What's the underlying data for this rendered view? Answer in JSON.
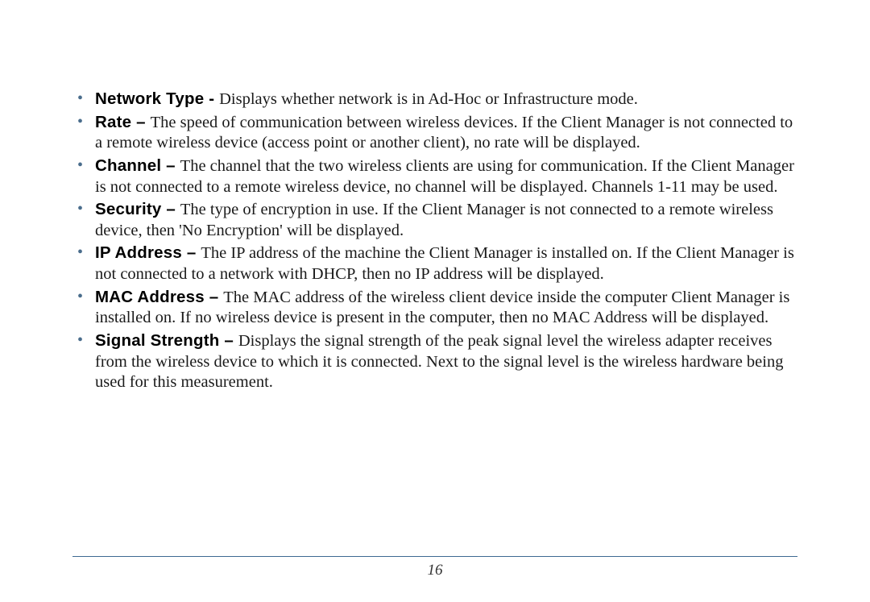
{
  "page_number": "16",
  "items": [
    {
      "term": "Network Type - ",
      "desc": "Displays whether network is in Ad-Hoc or Infrastructure mode."
    },
    {
      "term": "Rate – ",
      "desc": "The speed of communication between wireless devices.  If the Client Manager is not connected to a remote wireless device (access point or another client), no rate will be displayed."
    },
    {
      "term": "Channel – ",
      "desc": "The channel that the two wireless clients are using for communication.  If the Client Manager is not connected to a remote wireless device, no channel will be displayed.  Channels 1-11 may be used."
    },
    {
      "term": "Security – ",
      "desc": "The type of encryption in use.  If the Client Manager is not connected to a remote wireless device, then 'No Encryption' will be displayed."
    },
    {
      "term": "IP Address – ",
      "desc": "The IP address of the machine the Client Manager is installed on. If the Client Manager is not connected to a network with DHCP, then no IP address will be displayed."
    },
    {
      "term": "MAC Address – ",
      "desc": "The MAC address of the wireless client device inside the computer Client Manager is installed on. If no wireless device is present in the computer, then no MAC Address will be displayed."
    },
    {
      "term": "Signal Strength – ",
      "desc": "Displays the signal strength of the peak signal level the wireless adapter receives from the wireless device to which it is connected.  Next to the signal level is the wireless hardware being used for this measurement."
    }
  ]
}
